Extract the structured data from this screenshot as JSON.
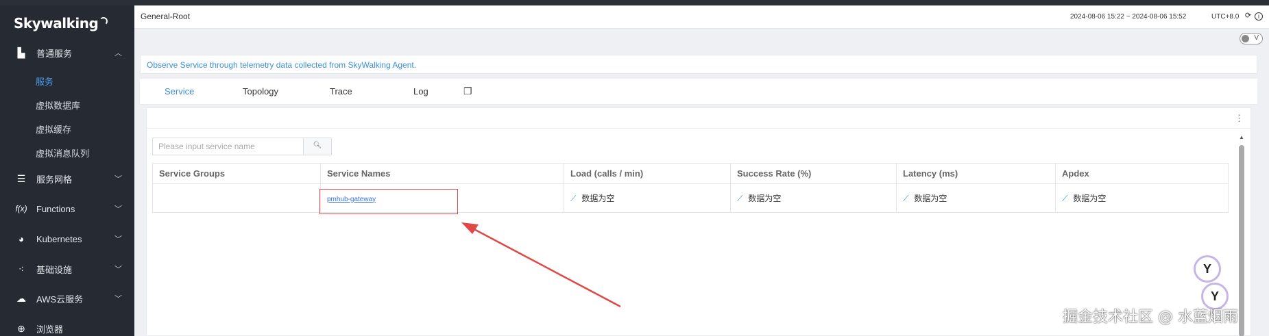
{
  "brand": {
    "logo_text": "Skywalking"
  },
  "sidebar": {
    "groups": [
      {
        "label": "普通服务",
        "icon": "bar-chart-icon",
        "expanded": true
      },
      {
        "label": "服务网格",
        "icon": "layers-icon"
      },
      {
        "label": "Functions",
        "icon": "function-icon"
      },
      {
        "label": "Kubernetes",
        "icon": "kubernetes-icon"
      },
      {
        "label": "基础设施",
        "icon": "nodes-icon"
      },
      {
        "label": "AWS云服务",
        "icon": "cloud-icon"
      },
      {
        "label": "浏览器",
        "icon": "globe-icon"
      }
    ],
    "sub_items": [
      {
        "label": "服务",
        "active": true
      },
      {
        "label": "虚拟数据库"
      },
      {
        "label": "虚拟缓存"
      },
      {
        "label": "虚拟消息队列"
      }
    ]
  },
  "header": {
    "breadcrumb": "General-Root",
    "time_range": "2024-08-06 15:22 ~ 2024-08-06 15:52",
    "timezone": "UTC+8.0",
    "toggle_label": "V"
  },
  "info": {
    "text": "Observe Service through telemetry data collected from SkyWalking Agent."
  },
  "tabs": [
    {
      "label": "Service",
      "active": true
    },
    {
      "label": "Topology"
    },
    {
      "label": "Trace"
    },
    {
      "label": "Log"
    }
  ],
  "search": {
    "placeholder": "Please input service name"
  },
  "table": {
    "headers": [
      "Service Groups",
      "Service Names",
      "Load (calls / min)",
      "Success Rate (%)",
      "Latency (ms)",
      "Apdex"
    ],
    "rows": [
      {
        "group": "",
        "service_name": "pmhub-gateway",
        "load": "数据为空",
        "success_rate": "数据为空",
        "latency": "数据为空",
        "apdex": "数据为空"
      }
    ]
  },
  "watermark": "掘金技术社区 @ 水蓝烟雨",
  "colors": {
    "accent": "#3d8fd8",
    "sidebar_bg": "#252a33",
    "highlight": "#e04848"
  }
}
